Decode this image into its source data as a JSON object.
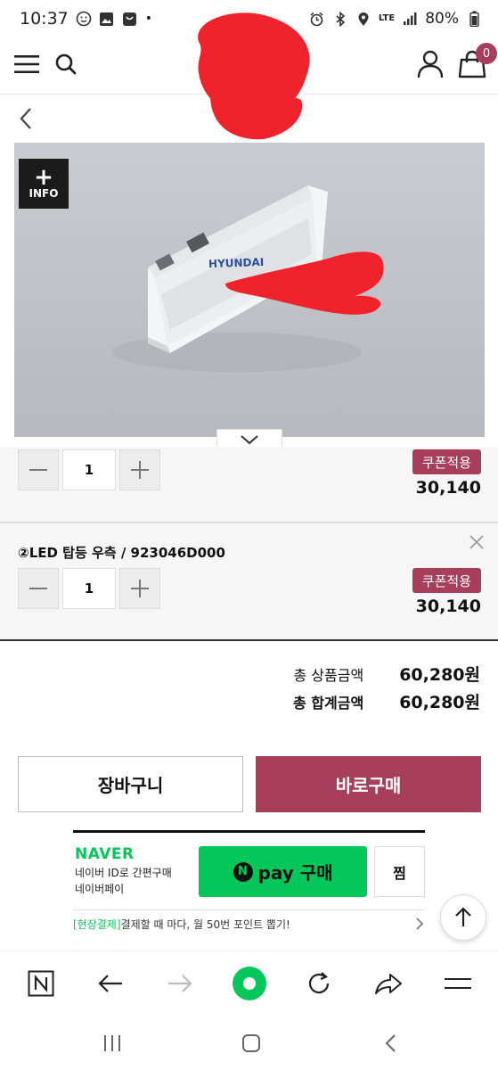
{
  "status_bar": {
    "time": "10:37",
    "network": "LTE",
    "battery": "80%"
  },
  "header": {
    "cart_count": "0"
  },
  "product_image": {
    "info_label": "INFO",
    "info_plus": "+",
    "brand_text": "HYUNDAI"
  },
  "options": [
    {
      "name": "",
      "quantity": "1",
      "coupon_label": "쿠폰적용",
      "price": "30,140"
    },
    {
      "name": "②LED 탑등 우측 / 923046D000",
      "quantity": "1",
      "coupon_label": "쿠폰적용",
      "price": "30,140"
    }
  ],
  "totals": {
    "product_total_label": "총 상품금액",
    "product_total_value": "60,280원",
    "grand_total_label": "총 합계금액",
    "grand_total_value": "60,280원"
  },
  "actions": {
    "cart_label": "장바구니",
    "buy_label": "바로구매"
  },
  "naver_pay": {
    "brand": "NAVER",
    "desc_line1": "네이버 ID로 간편구매",
    "desc_line2": "네이버페이",
    "pay_n": "N",
    "pay_label": "pay 구매",
    "wish_label": "찜",
    "promo_tag": "[현장결제]",
    "promo_text": "결제할 때 마다, 월 50번 포인트 뽑기!"
  },
  "colors": {
    "accent": "#a73e5c",
    "naver_green": "#03c75a"
  }
}
